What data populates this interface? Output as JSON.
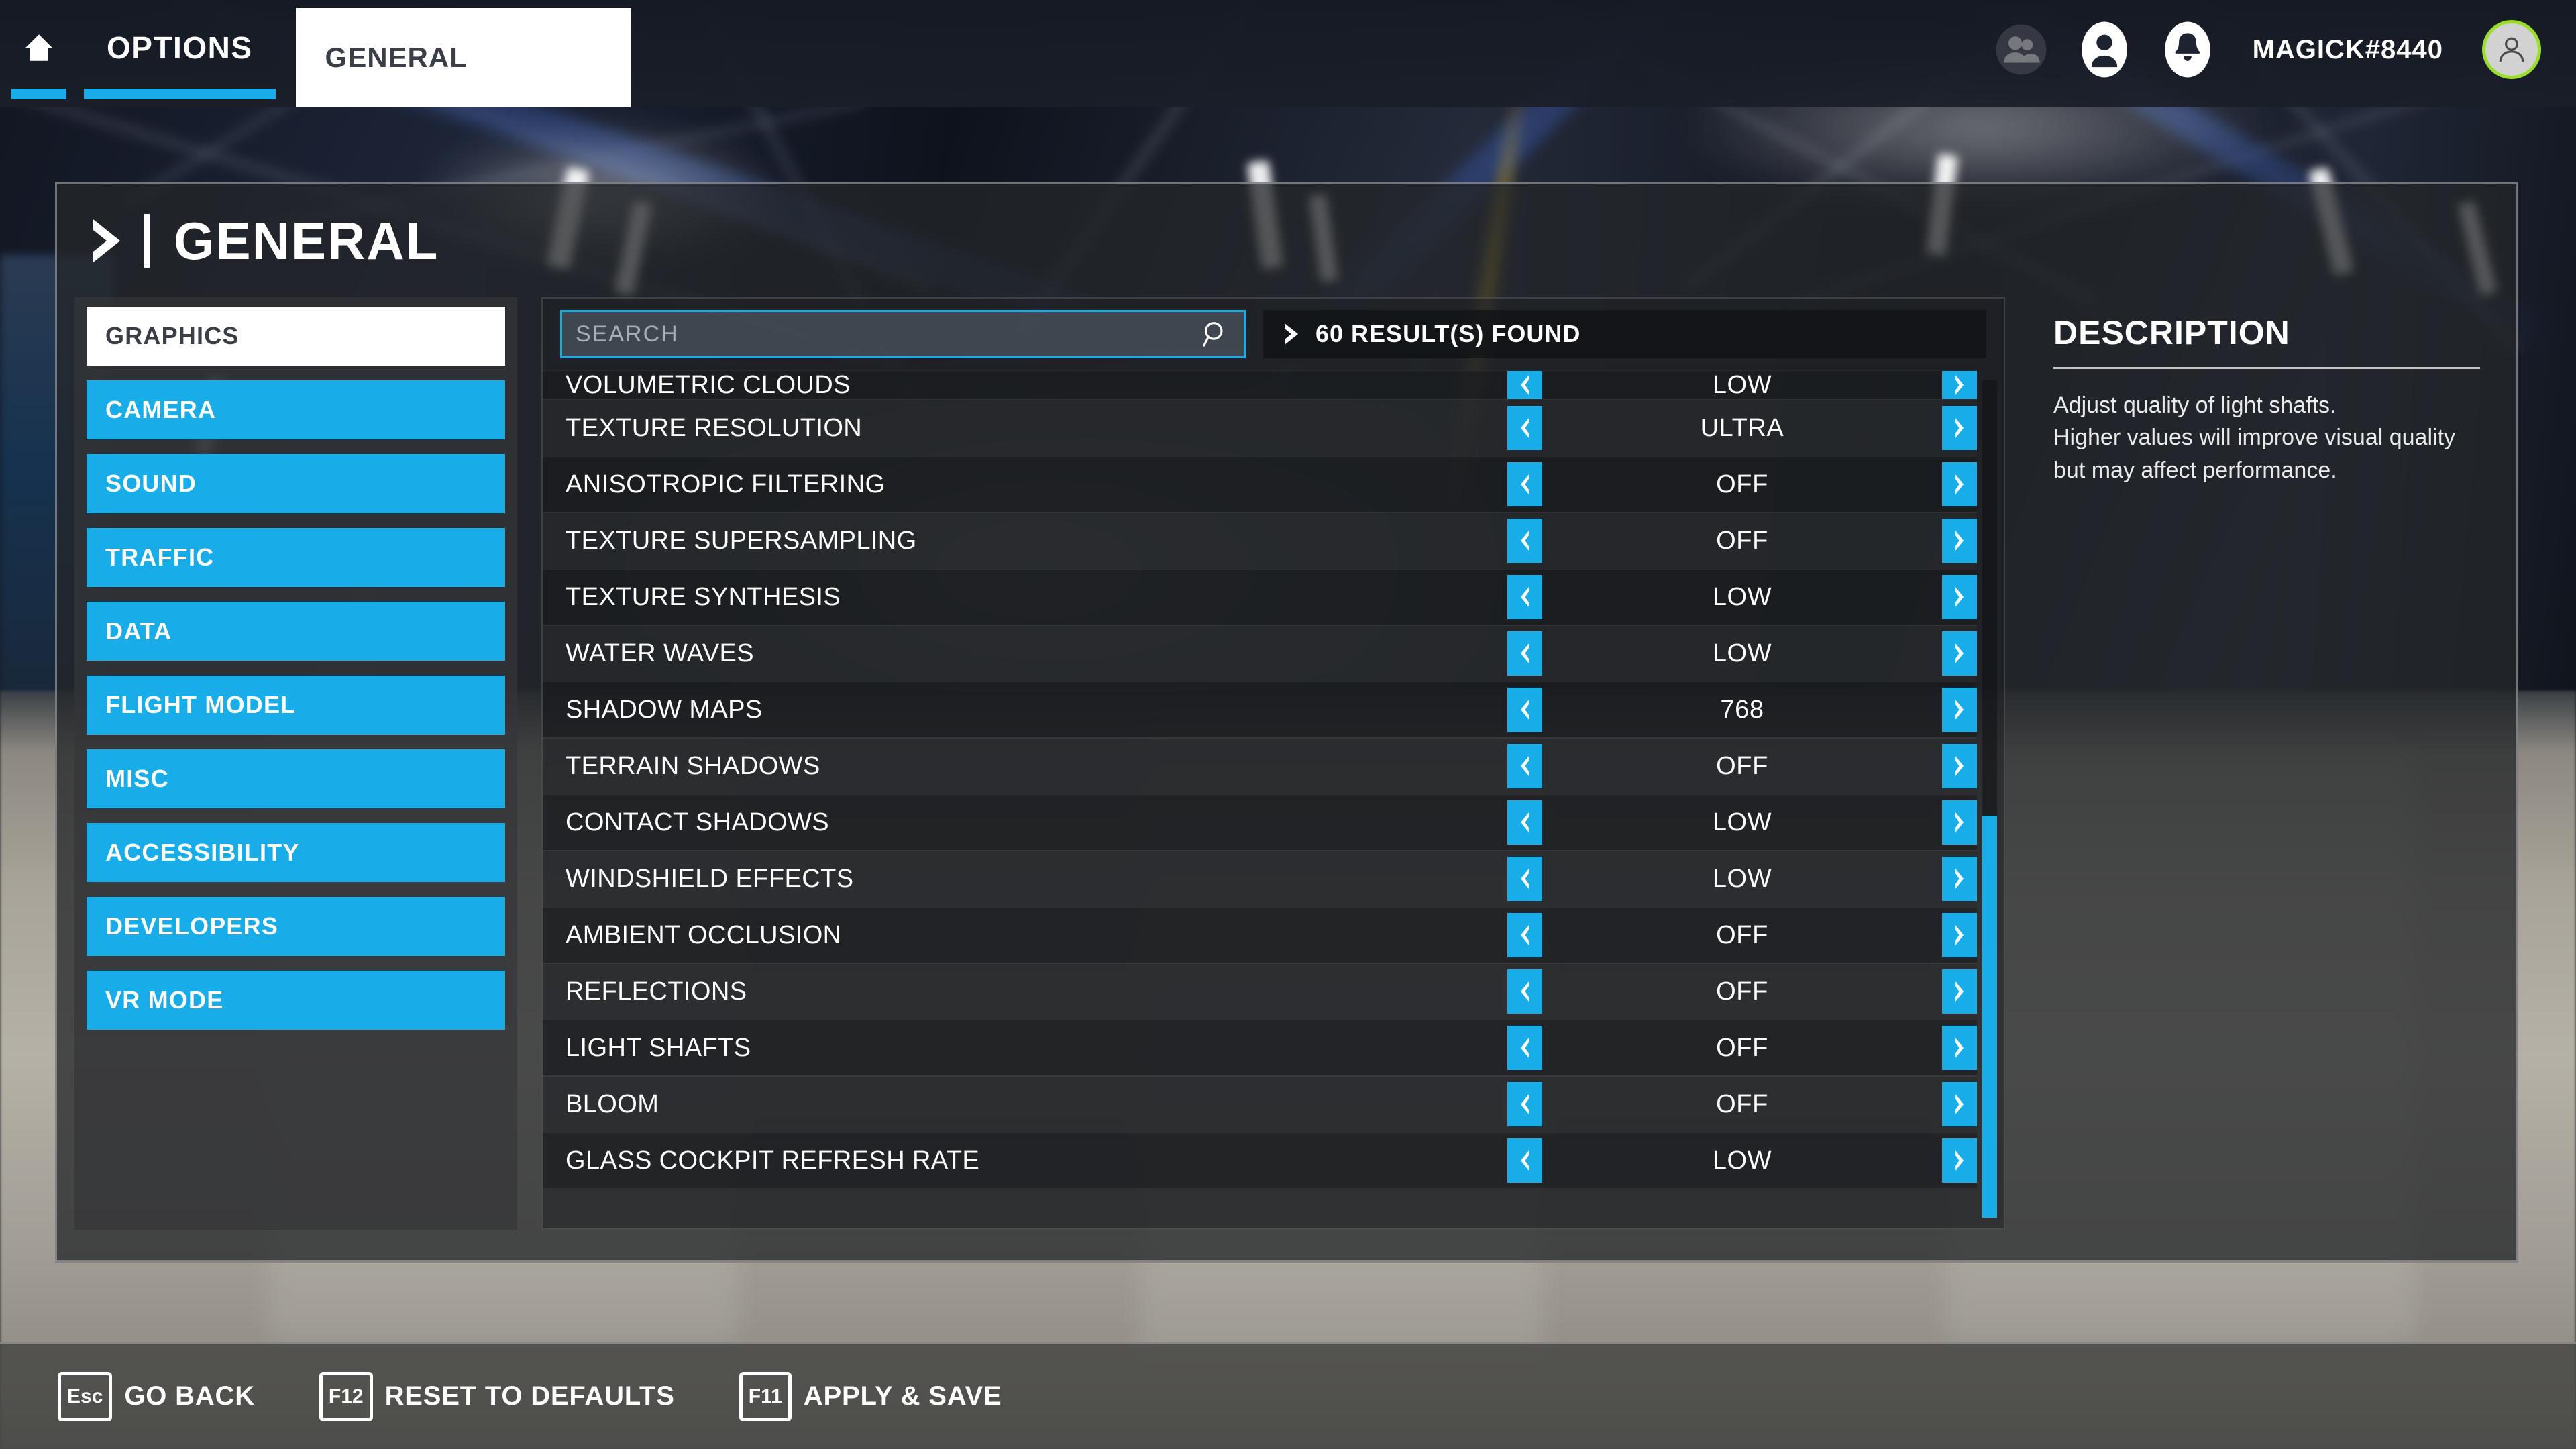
{
  "colors": {
    "accent_blue": "#18ade8",
    "avatar_ring_green": "#9ade2a",
    "panel_white": "#ffffff",
    "text_dark": "#3a3f47"
  },
  "topnav": {
    "home_icon": "home-icon",
    "options_label": "OPTIONS",
    "active_tab_label": "GENERAL",
    "friends_icon": "people-icon",
    "profile_icon": "person-icon",
    "notification_icon": "bell-icon",
    "username": "MAGICK#8440",
    "avatar_icon": "avatar-person-icon"
  },
  "panel": {
    "title": "GENERAL",
    "title_chevron_icon": "chevron-right-icon"
  },
  "sidebar": {
    "items": [
      {
        "label": "GRAPHICS",
        "active": true
      },
      {
        "label": "CAMERA",
        "active": false
      },
      {
        "label": "SOUND",
        "active": false
      },
      {
        "label": "TRAFFIC",
        "active": false
      },
      {
        "label": "DATA",
        "active": false
      },
      {
        "label": "FLIGHT MODEL",
        "active": false
      },
      {
        "label": "MISC",
        "active": false
      },
      {
        "label": "ACCESSIBILITY",
        "active": false
      },
      {
        "label": "DEVELOPERS",
        "active": false
      },
      {
        "label": "VR MODE",
        "active": false
      }
    ]
  },
  "search": {
    "value": "",
    "placeholder": "SEARCH",
    "icon": "search-icon"
  },
  "results": {
    "text": "60 RESULT(S) FOUND",
    "count": 60,
    "chevron_icon": "chevron-right-icon"
  },
  "settings": {
    "prev_icon": "chevron-left-icon",
    "next_icon": "chevron-right-icon",
    "rows": [
      {
        "name": "VOLUMETRIC CLOUDS",
        "value": "LOW",
        "clipped": true
      },
      {
        "name": "TEXTURE RESOLUTION",
        "value": "ULTRA",
        "clipped": false
      },
      {
        "name": "ANISOTROPIC FILTERING",
        "value": "OFF",
        "clipped": false
      },
      {
        "name": "TEXTURE SUPERSAMPLING",
        "value": "OFF",
        "clipped": false
      },
      {
        "name": "TEXTURE SYNTHESIS",
        "value": "LOW",
        "clipped": false
      },
      {
        "name": "WATER WAVES",
        "value": "LOW",
        "clipped": false
      },
      {
        "name": "SHADOW MAPS",
        "value": "768",
        "clipped": false
      },
      {
        "name": "TERRAIN SHADOWS",
        "value": "OFF",
        "clipped": false
      },
      {
        "name": "CONTACT SHADOWS",
        "value": "LOW",
        "clipped": false
      },
      {
        "name": "WINDSHIELD EFFECTS",
        "value": "LOW",
        "clipped": false
      },
      {
        "name": "AMBIENT OCCLUSION",
        "value": "OFF",
        "clipped": false
      },
      {
        "name": "REFLECTIONS",
        "value": "OFF",
        "clipped": false
      },
      {
        "name": "LIGHT SHAFTS",
        "value": "OFF",
        "clipped": false
      },
      {
        "name": "BLOOM",
        "value": "OFF",
        "clipped": false
      },
      {
        "name": "GLASS COCKPIT REFRESH RATE",
        "value": "LOW",
        "clipped": false
      }
    ]
  },
  "scrollbar": {
    "thumb_top_pct": 52,
    "thumb_height_pct": 48
  },
  "description": {
    "title": "DESCRIPTION",
    "lines": [
      "Adjust quality of light shafts.",
      "Higher values will improve visual quality",
      "but may affect performance."
    ]
  },
  "footer": {
    "actions": [
      {
        "key": "Esc",
        "label": "GO BACK"
      },
      {
        "key": "F12",
        "label": "RESET TO DEFAULTS"
      },
      {
        "key": "F11",
        "label": "APPLY & SAVE"
      }
    ]
  }
}
